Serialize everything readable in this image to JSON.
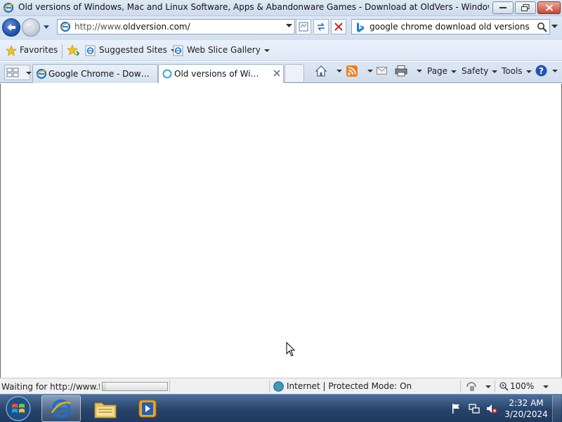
{
  "window": {
    "title": "Old versions of Windows, Mac and Linux Software, Apps & Abandonware Games - Download at OldVers - Windows Internet E..."
  },
  "address_bar": {
    "url_prefix": "http://www.",
    "url_domain": "oldversion.com/"
  },
  "search_bar": {
    "query": "google chrome download old versions"
  },
  "favorites_bar": {
    "favorites_label": "Favorites",
    "suggested_sites_label": "Suggested Sites",
    "web_slice_gallery_label": "Web Slice Gallery"
  },
  "tabs": [
    {
      "label": "Google Chrome - Downlo...",
      "active": false
    },
    {
      "label": "Old versions of Windo...",
      "active": true
    }
  ],
  "command_bar": {
    "page_label": "Page",
    "safety_label": "Safety",
    "tools_label": "Tools"
  },
  "status_bar": {
    "status_text": "Waiting for http://www.fa",
    "progress": 0.05,
    "zone_text": "Internet | Protected Mode: On",
    "zoom_text": "100%"
  },
  "taskbar": {
    "time": "2:32 AM",
    "date": "3/20/2024"
  },
  "colors": {
    "titlebar": "#dfe9f5",
    "taskbar": "#27436a",
    "close_button": "#c9452f",
    "ie_blue": "#1c6fd1"
  }
}
